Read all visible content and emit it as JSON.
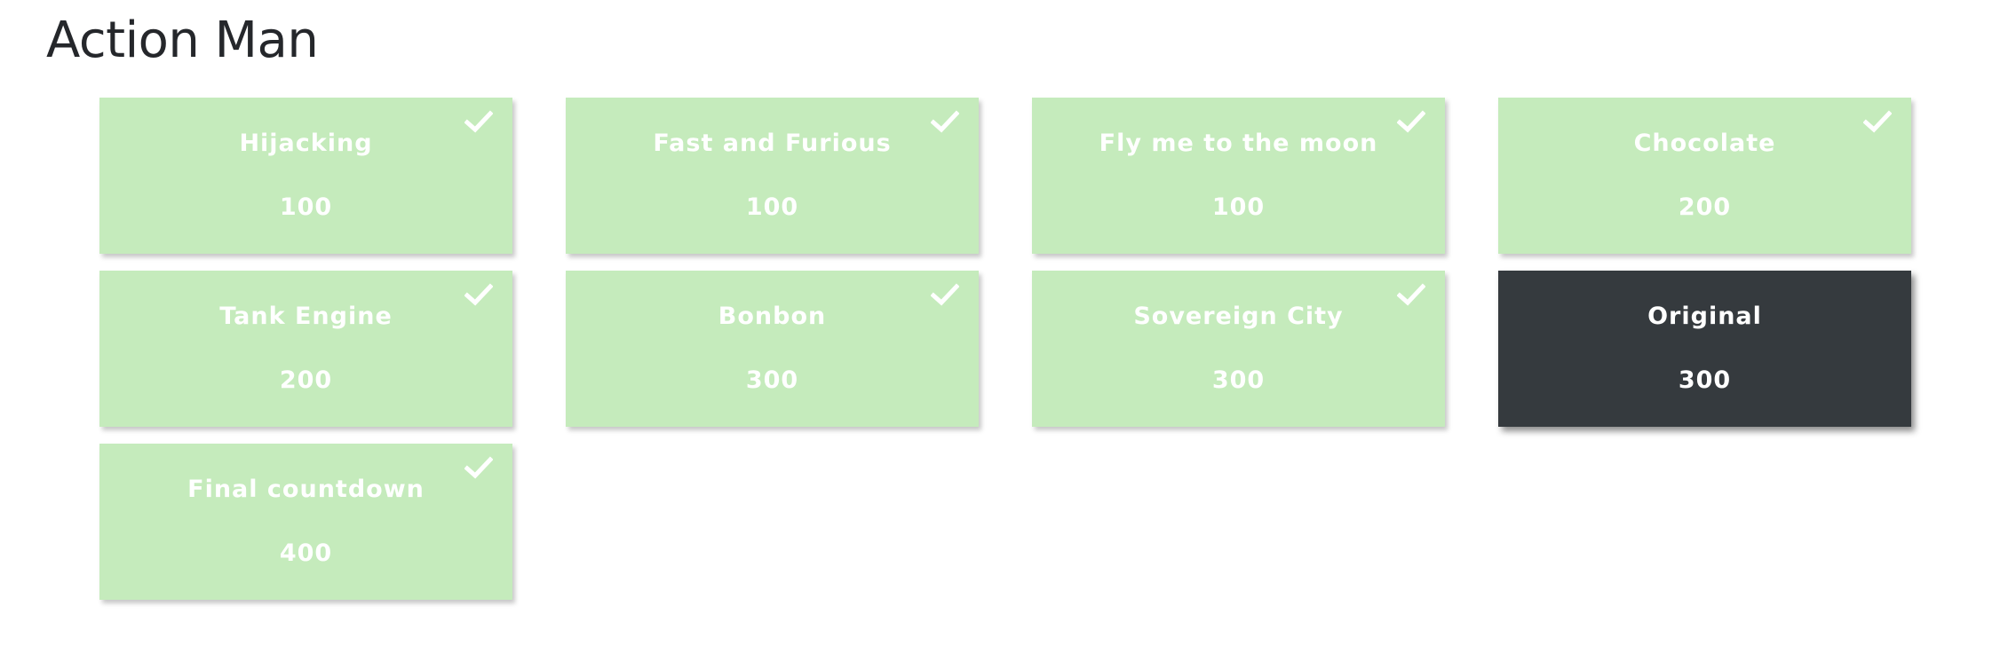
{
  "page": {
    "title": "Action Man"
  },
  "tiles": [
    {
      "title": "Hijacking",
      "points": "100",
      "solved": true
    },
    {
      "title": "Fast and Furious",
      "points": "100",
      "solved": true
    },
    {
      "title": "Fly me to the moon",
      "points": "100",
      "solved": true
    },
    {
      "title": "Chocolate",
      "points": "200",
      "solved": true
    },
    {
      "title": "Tank Engine",
      "points": "200",
      "solved": true
    },
    {
      "title": "Bonbon",
      "points": "300",
      "solved": true
    },
    {
      "title": "Sovereign City",
      "points": "300",
      "solved": true
    },
    {
      "title": "Original",
      "points": "300",
      "solved": false
    },
    {
      "title": "Final countdown",
      "points": "400",
      "solved": true
    }
  ],
  "colors": {
    "solved_tile": "#c5ebbc",
    "unsolved_tile": "#353a3e",
    "tile_text": "#ffffff",
    "title_text": "#25272b"
  },
  "icons": {
    "solved_marker": "check-icon"
  }
}
